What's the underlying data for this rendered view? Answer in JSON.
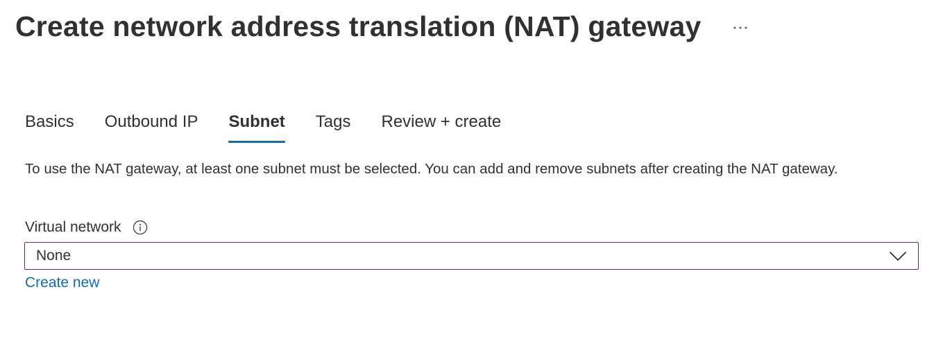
{
  "header": {
    "title": "Create network address translation (NAT) gateway",
    "more_icon": "ellipsis-icon"
  },
  "tabs": [
    {
      "label": "Basics",
      "active": false
    },
    {
      "label": "Outbound IP",
      "active": false
    },
    {
      "label": "Subnet",
      "active": true
    },
    {
      "label": "Tags",
      "active": false
    },
    {
      "label": "Review + create",
      "active": false
    }
  ],
  "main": {
    "description": "To use the NAT gateway, at least one subnet must be selected. You can add and remove subnets after creating the NAT gateway.",
    "virtual_network": {
      "label": "Virtual network",
      "info_icon": "info-icon",
      "value": "None",
      "dropdown_icon": "chevron-down-icon",
      "create_new_label": "Create new"
    }
  },
  "colors": {
    "accent": "#0f6cbd",
    "select_border": "#6b2a6f",
    "text": "#323130"
  }
}
